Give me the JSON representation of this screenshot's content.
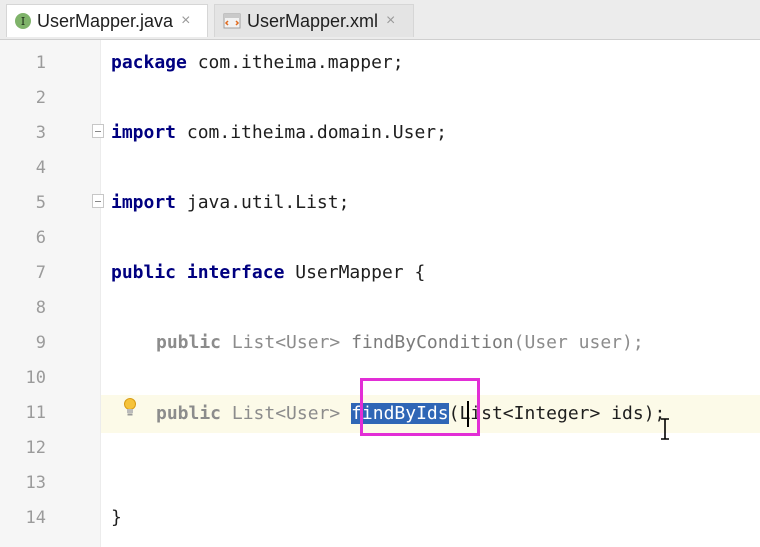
{
  "tabs": [
    {
      "label": "UserMapper.java",
      "icon": "java-interface-icon",
      "icon_letter": "I",
      "active": true
    },
    {
      "label": "UserMapper.xml",
      "icon": "xml-file-icon",
      "active": false
    }
  ],
  "close_glyph": "×",
  "line_numbers": [
    "1",
    "2",
    "3",
    "4",
    "5",
    "6",
    "7",
    "8",
    "9",
    "10",
    "11",
    "12",
    "13",
    "14"
  ],
  "code": {
    "l1_kw": "package",
    "l1_rest": " com.itheima.mapper;",
    "l3_kw": "import",
    "l3_rest": " com.itheima.domain.User;",
    "l5_kw": "import",
    "l5_rest": " java.util.List;",
    "l7_kw1": "public",
    "l7_kw2": " interface",
    "l7_rest": " UserMapper {",
    "l9_kw": "public",
    "l9_type": " List<User> ",
    "l9_fn": "findByCondition",
    "l9_rest": "(User user);",
    "l11_kw": "public",
    "l11_type": " List<User> ",
    "l11_fn": "findByIds",
    "l11_rest": "(List<Integer> ids);",
    "l14": "}"
  },
  "colors": {
    "selection": "#2f66b6",
    "highlight_box": "#e22ed6",
    "current_line": "#fcfae8"
  }
}
